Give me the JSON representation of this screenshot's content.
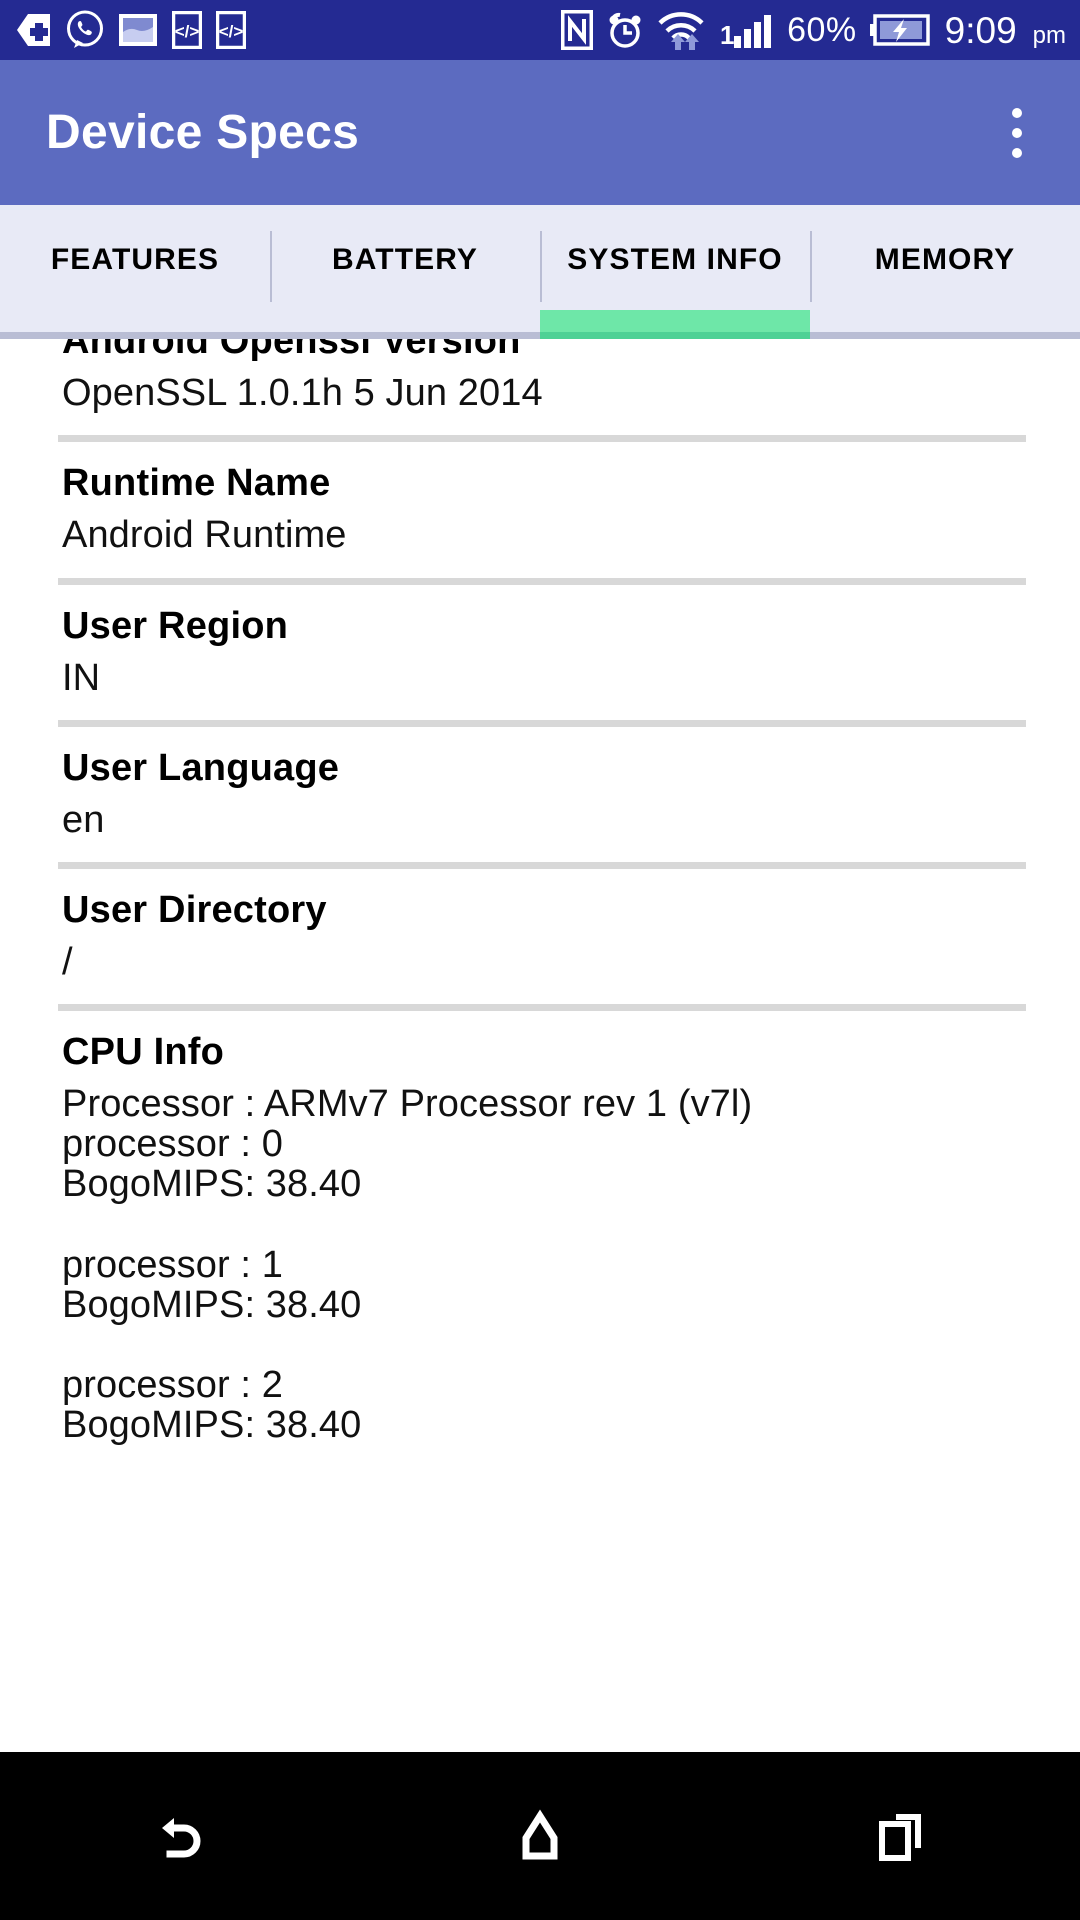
{
  "statusbar": {
    "icons_left": [
      "tag-plus-icon",
      "whatsapp-icon",
      "screenshot-image-icon",
      "code-icon",
      "code-icon"
    ],
    "icons_right": [
      "nfc-icon",
      "alarm-clock-icon",
      "wifi-icon",
      "signal-bars-icon"
    ],
    "signal_label": "1",
    "battery_percent": "60%",
    "battery_icon": "battery-charging-icon",
    "time": "9:09",
    "ampm": "pm",
    "background": "#242a92"
  },
  "appbar": {
    "title": "Device Specs",
    "overflow_label": "overflow-menu",
    "background": "#5c6bc0"
  },
  "tabs": {
    "items": [
      {
        "label": "FEATURES",
        "active": false
      },
      {
        "label": "BATTERY",
        "active": false
      },
      {
        "label": "SYSTEM INFO",
        "active": true
      },
      {
        "label": "MEMORY",
        "active": false
      }
    ],
    "indicator_color": "#6ee7a8",
    "background": "#e8eaf6"
  },
  "content": {
    "rows": [
      {
        "title": "Android Openssl Version",
        "value": "OpenSSL 1.0.1h 5 Jun 2014"
      },
      {
        "title": "Runtime Name",
        "value": "Android Runtime"
      },
      {
        "title": "User Region",
        "value": "IN"
      },
      {
        "title": "User Language",
        "value": "en"
      },
      {
        "title": "User Directory",
        "value": "/"
      },
      {
        "title": "CPU Info",
        "value": "Processor : ARMv7 Processor rev 1 (v7l)\nprocessor : 0\nBogoMIPS: 38.40\n\nprocessor : 1\nBogoMIPS: 38.40\n\nprocessor : 2\nBogoMIPS: 38.40"
      }
    ]
  },
  "navbar": {
    "buttons": [
      "back-button",
      "home-button",
      "recents-button"
    ],
    "background": "#000000"
  }
}
